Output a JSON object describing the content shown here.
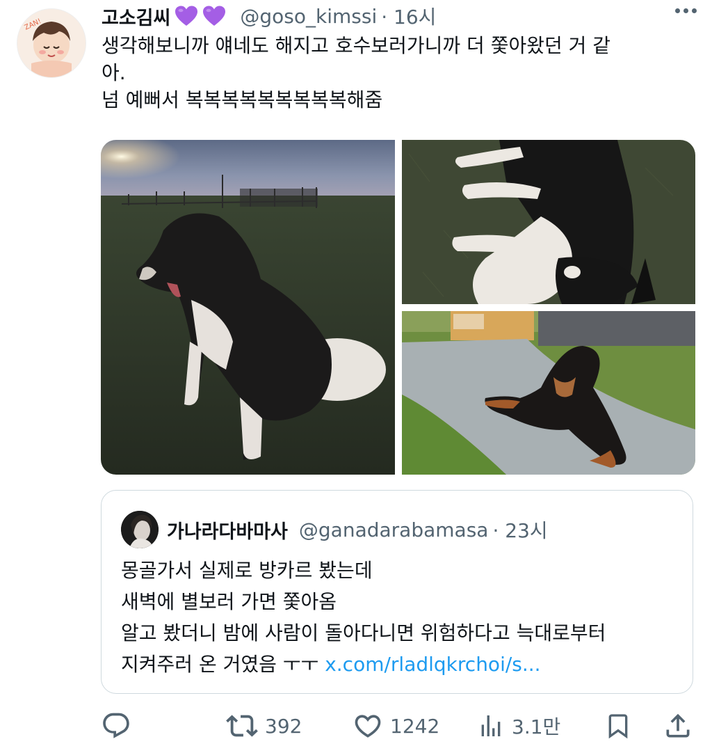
{
  "tweet": {
    "display_name": "고소김씨",
    "emoji": "purple-heart",
    "handle": "@goso_kimssi",
    "time": "· 16시",
    "text_lines": [
      "생각해보니까 얘네도 해지고 호수보러가니까 더 쫓아왔던 거 같",
      "아.",
      "넘 예뻐서 복복복복복복복복복해줌"
    ]
  },
  "media": {
    "photos": [
      "dog-sitting-at-dusk-photo",
      "dog-lying-on-grass-photo",
      "dog-lying-on-path-photo"
    ]
  },
  "quote": {
    "display_name": "가나라다바마사",
    "handle": "@ganadarabamasa",
    "time": "· 23시",
    "lines": [
      "몽골가서 실제로 방카르 봤는데",
      "새벽에 별보러 가면 쫓아옴",
      "알고 봤더니 밤에 사람이 돌아다니면 위험하다고 늑대로부터",
      "지켜주러 온 거였음 ㅜㅜ "
    ],
    "link": "x.com/rladlqkrchoi/s..."
  },
  "actions": {
    "reply_count": "",
    "retweet_count": "392",
    "like_count": "1242",
    "views_count": "3.1만"
  },
  "colors": {
    "text": "#0f1419",
    "secondary": "#536471",
    "link": "#1d9bf0",
    "heart_purple": "#a45ee5",
    "border": "#cfd9de"
  }
}
